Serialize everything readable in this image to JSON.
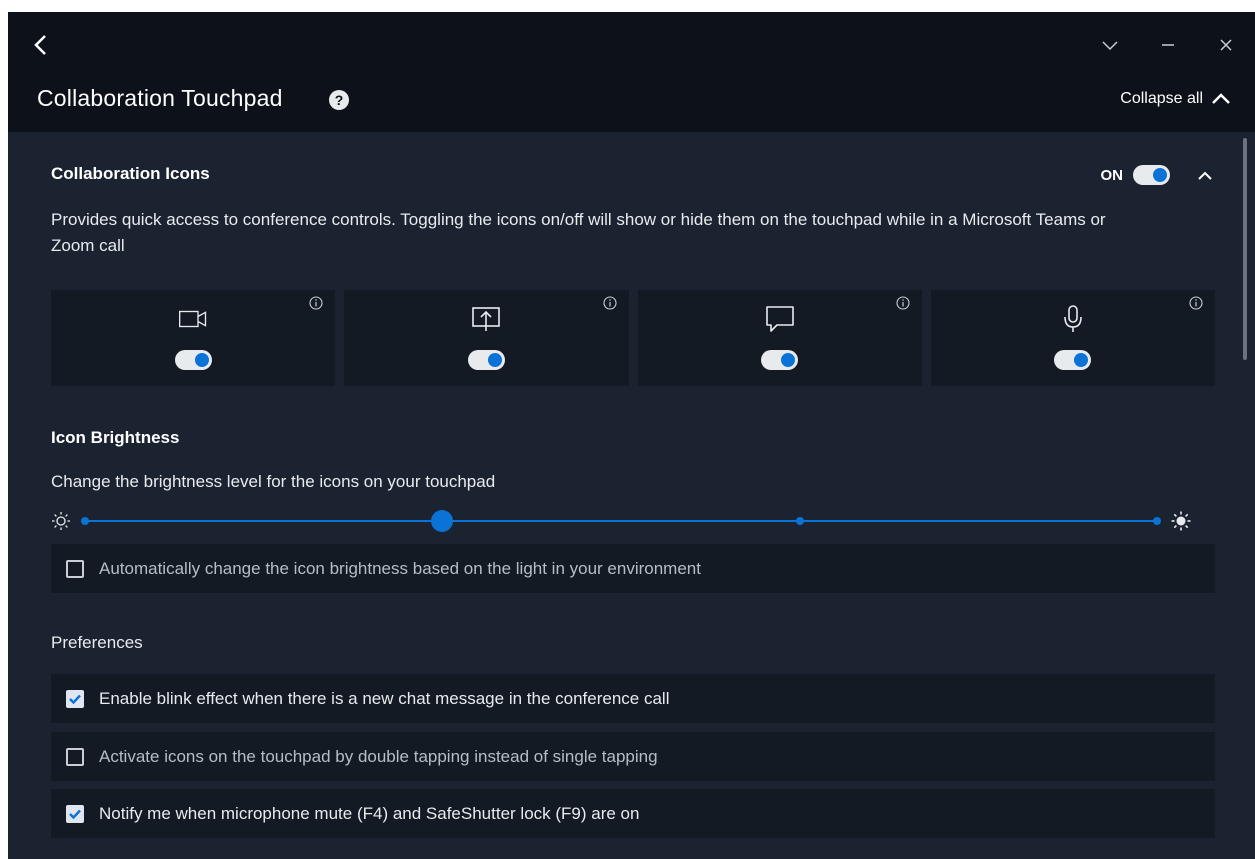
{
  "window": {
    "title": "Collaboration Touchpad",
    "help_icon": "question-circle-icon",
    "collapse_all_label": "Collapse all",
    "controls": [
      "chevron-down-icon",
      "minimize-icon",
      "close-icon"
    ]
  },
  "collab_icons": {
    "title": "Collaboration Icons",
    "state_label": "ON",
    "enabled": true,
    "description": "Provides quick access to conference controls. Toggling the icons on/off will show or hide them on the touchpad while in a Microsoft Teams or Zoom call",
    "tiles": [
      {
        "icon": "video-camera-icon",
        "enabled": true
      },
      {
        "icon": "share-screen-icon",
        "enabled": true
      },
      {
        "icon": "chat-icon",
        "enabled": true
      },
      {
        "icon": "microphone-icon",
        "enabled": true
      }
    ]
  },
  "brightness": {
    "title": "Icon Brightness",
    "description": "Change the brightness level for the icons on your touchpad",
    "levels": 4,
    "selected_level": 2,
    "auto_label": "Automatically change the icon brightness based on the light in your environment",
    "auto_checked": false
  },
  "preferences": {
    "title": "Preferences",
    "items": [
      {
        "label": "Enable blink effect when there is a new chat message in the conference call",
        "checked": true
      },
      {
        "label": "Activate icons on the touchpad by double tapping instead of single tapping",
        "checked": false
      },
      {
        "label": "Notify me when microphone mute (F4) and SafeShutter lock (F9) are on",
        "checked": true
      }
    ]
  },
  "colors": {
    "accent": "#0b72d6",
    "panel_bg": "#1b2330",
    "header_bg": "#0d121a",
    "tile_bg": "#131a24"
  }
}
